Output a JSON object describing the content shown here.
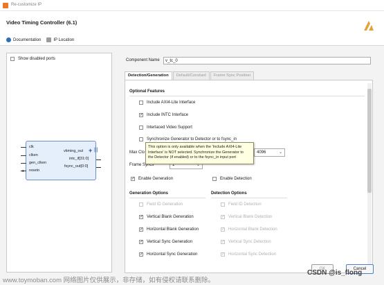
{
  "window": {
    "title": "Re-customize IP"
  },
  "header": {
    "ip_title": "Video Timing Controller (6.1)",
    "nav": [
      {
        "label": "Documentation",
        "icon": "info-icon"
      },
      {
        "label": "IP Location",
        "icon": "folder-icon"
      }
    ],
    "logo": "xilinx-logo-icon"
  },
  "left": {
    "show_disabled_ports_label": "Show disabled ports",
    "show_disabled_ports_checked": false,
    "ports_left": [
      "clk",
      "clken",
      "gen_clken",
      "resetn"
    ],
    "ports_right": [
      "vtiming_out",
      "intc_if[31:0]",
      "fsync_out[0:0]"
    ]
  },
  "component": {
    "label": "Component Name",
    "value": "v_tc_0"
  },
  "tabs": [
    {
      "label": "Detection/Generation",
      "active": true
    },
    {
      "label": "Default/Constant",
      "active": false
    },
    {
      "label": "Frame Sync Position",
      "active": false
    }
  ],
  "optional_features": {
    "title": "Optional Features",
    "items": [
      {
        "label": "Include AXI4-Lite Interface",
        "checked": false,
        "disabled": false
      },
      {
        "label": "Include INTC Interface",
        "checked": true,
        "disabled": false
      },
      {
        "label": "Interlaced Video Support",
        "checked": false,
        "disabled": false
      },
      {
        "label": "Synchronize Generator to Detector or to fsync_in",
        "checked": false,
        "disabled": false
      }
    ]
  },
  "max_clocks": {
    "label": "Max Clo",
    "value": "4096"
  },
  "frame_syncs": {
    "label": "Frame Syncs",
    "value": "1"
  },
  "tooltip": {
    "lines": [
      "This option is only available when the 'Include AXI4-Lite",
      "Interface' is NOT selected. Synchronize the Generator to",
      "the Detector (if enabled) or to the fsync_in input port"
    ]
  },
  "enable_generation": {
    "label": "Enable Generation",
    "checked": true
  },
  "enable_detection": {
    "label": "Enable Detection",
    "checked": false
  },
  "generation_options": {
    "title": "Generation Options",
    "items": [
      {
        "label": "Field ID Generation",
        "checked": false,
        "disabled": true
      },
      {
        "label": "Vertical Blank Generation",
        "checked": true,
        "disabled": false
      },
      {
        "label": "Horizontal Blank Generation",
        "checked": true,
        "disabled": false
      },
      {
        "label": "Vertical Sync Generation",
        "checked": true,
        "disabled": false
      },
      {
        "label": "Horizontal Sync Generation",
        "checked": true,
        "disabled": false
      }
    ]
  },
  "detection_options": {
    "title": "Detection Options",
    "items": [
      {
        "label": "Field ID Detection",
        "checked": false,
        "disabled": true
      },
      {
        "label": "Vertical Blank Detection",
        "checked": true,
        "disabled": true
      },
      {
        "label": "Horizontal Blank Detection",
        "checked": true,
        "disabled": true
      },
      {
        "label": "Vertical Sync Detection",
        "checked": true,
        "disabled": true
      },
      {
        "label": "Horizontal Sync Detection",
        "checked": true,
        "disabled": true
      }
    ]
  },
  "buttons": {
    "ok": "OK",
    "cancel": "Cancel"
  },
  "watermark": "www.toymoban.com 网络图片仅供展示，非存储，如有侵权请联系删除。",
  "credit": "CSDN @is_flong",
  "colors": {
    "block_fill": "#e5eefb",
    "block_border": "#6b8fc9",
    "tooltip_bg": "#ffffe1",
    "logo": "#e2a33a"
  }
}
